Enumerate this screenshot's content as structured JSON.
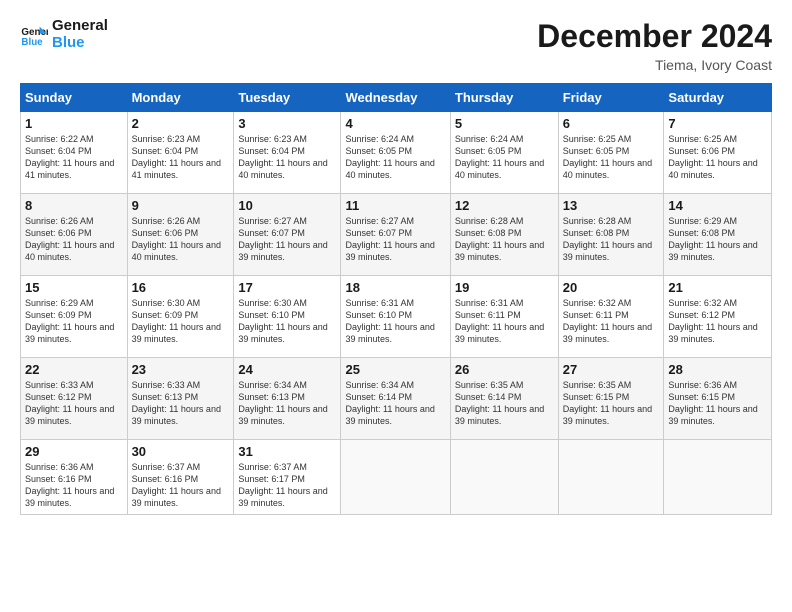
{
  "logo": {
    "line1": "General",
    "line2": "Blue"
  },
  "header": {
    "month": "December 2024",
    "location": "Tiema, Ivory Coast"
  },
  "weekdays": [
    "Sunday",
    "Monday",
    "Tuesday",
    "Wednesday",
    "Thursday",
    "Friday",
    "Saturday"
  ],
  "weeks": [
    [
      {
        "day": "1",
        "sunrise": "6:22 AM",
        "sunset": "6:04 PM",
        "daylight": "11 hours and 41 minutes."
      },
      {
        "day": "2",
        "sunrise": "6:23 AM",
        "sunset": "6:04 PM",
        "daylight": "11 hours and 41 minutes."
      },
      {
        "day": "3",
        "sunrise": "6:23 AM",
        "sunset": "6:04 PM",
        "daylight": "11 hours and 40 minutes."
      },
      {
        "day": "4",
        "sunrise": "6:24 AM",
        "sunset": "6:05 PM",
        "daylight": "11 hours and 40 minutes."
      },
      {
        "day": "5",
        "sunrise": "6:24 AM",
        "sunset": "6:05 PM",
        "daylight": "11 hours and 40 minutes."
      },
      {
        "day": "6",
        "sunrise": "6:25 AM",
        "sunset": "6:05 PM",
        "daylight": "11 hours and 40 minutes."
      },
      {
        "day": "7",
        "sunrise": "6:25 AM",
        "sunset": "6:06 PM",
        "daylight": "11 hours and 40 minutes."
      }
    ],
    [
      {
        "day": "8",
        "sunrise": "6:26 AM",
        "sunset": "6:06 PM",
        "daylight": "11 hours and 40 minutes."
      },
      {
        "day": "9",
        "sunrise": "6:26 AM",
        "sunset": "6:06 PM",
        "daylight": "11 hours and 40 minutes."
      },
      {
        "day": "10",
        "sunrise": "6:27 AM",
        "sunset": "6:07 PM",
        "daylight": "11 hours and 39 minutes."
      },
      {
        "day": "11",
        "sunrise": "6:27 AM",
        "sunset": "6:07 PM",
        "daylight": "11 hours and 39 minutes."
      },
      {
        "day": "12",
        "sunrise": "6:28 AM",
        "sunset": "6:08 PM",
        "daylight": "11 hours and 39 minutes."
      },
      {
        "day": "13",
        "sunrise": "6:28 AM",
        "sunset": "6:08 PM",
        "daylight": "11 hours and 39 minutes."
      },
      {
        "day": "14",
        "sunrise": "6:29 AM",
        "sunset": "6:08 PM",
        "daylight": "11 hours and 39 minutes."
      }
    ],
    [
      {
        "day": "15",
        "sunrise": "6:29 AM",
        "sunset": "6:09 PM",
        "daylight": "11 hours and 39 minutes."
      },
      {
        "day": "16",
        "sunrise": "6:30 AM",
        "sunset": "6:09 PM",
        "daylight": "11 hours and 39 minutes."
      },
      {
        "day": "17",
        "sunrise": "6:30 AM",
        "sunset": "6:10 PM",
        "daylight": "11 hours and 39 minutes."
      },
      {
        "day": "18",
        "sunrise": "6:31 AM",
        "sunset": "6:10 PM",
        "daylight": "11 hours and 39 minutes."
      },
      {
        "day": "19",
        "sunrise": "6:31 AM",
        "sunset": "6:11 PM",
        "daylight": "11 hours and 39 minutes."
      },
      {
        "day": "20",
        "sunrise": "6:32 AM",
        "sunset": "6:11 PM",
        "daylight": "11 hours and 39 minutes."
      },
      {
        "day": "21",
        "sunrise": "6:32 AM",
        "sunset": "6:12 PM",
        "daylight": "11 hours and 39 minutes."
      }
    ],
    [
      {
        "day": "22",
        "sunrise": "6:33 AM",
        "sunset": "6:12 PM",
        "daylight": "11 hours and 39 minutes."
      },
      {
        "day": "23",
        "sunrise": "6:33 AM",
        "sunset": "6:13 PM",
        "daylight": "11 hours and 39 minutes."
      },
      {
        "day": "24",
        "sunrise": "6:34 AM",
        "sunset": "6:13 PM",
        "daylight": "11 hours and 39 minutes."
      },
      {
        "day": "25",
        "sunrise": "6:34 AM",
        "sunset": "6:14 PM",
        "daylight": "11 hours and 39 minutes."
      },
      {
        "day": "26",
        "sunrise": "6:35 AM",
        "sunset": "6:14 PM",
        "daylight": "11 hours and 39 minutes."
      },
      {
        "day": "27",
        "sunrise": "6:35 AM",
        "sunset": "6:15 PM",
        "daylight": "11 hours and 39 minutes."
      },
      {
        "day": "28",
        "sunrise": "6:36 AM",
        "sunset": "6:15 PM",
        "daylight": "11 hours and 39 minutes."
      }
    ],
    [
      {
        "day": "29",
        "sunrise": "6:36 AM",
        "sunset": "6:16 PM",
        "daylight": "11 hours and 39 minutes."
      },
      {
        "day": "30",
        "sunrise": "6:37 AM",
        "sunset": "6:16 PM",
        "daylight": "11 hours and 39 minutes."
      },
      {
        "day": "31",
        "sunrise": "6:37 AM",
        "sunset": "6:17 PM",
        "daylight": "11 hours and 39 minutes."
      },
      null,
      null,
      null,
      null
    ]
  ]
}
